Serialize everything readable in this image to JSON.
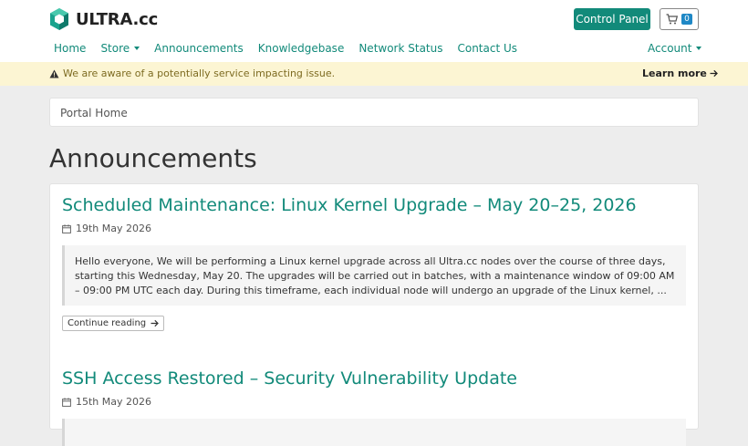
{
  "brand": {
    "name": "ULTRA.cc"
  },
  "header": {
    "control_panel_label": "Control Panel",
    "cart_count": "0"
  },
  "nav": {
    "items": [
      {
        "label": "Home"
      },
      {
        "label": "Store",
        "dropdown": true
      },
      {
        "label": "Announcements"
      },
      {
        "label": "Knowledgebase"
      },
      {
        "label": "Network Status"
      },
      {
        "label": "Contact Us"
      }
    ],
    "account_label": "Account"
  },
  "alert": {
    "message": "We are aware of a potentially service impacting issue.",
    "link_label": "Learn more"
  },
  "breadcrumb": {
    "label": "Portal Home"
  },
  "page": {
    "title": "Announcements"
  },
  "announcements": [
    {
      "title": "Scheduled Maintenance: Linux Kernel Upgrade – May 20–25, 2026",
      "date": "19th May 2026",
      "excerpt": "Hello everyone, We will be performing a Linux kernel upgrade across all Ultra.cc nodes over the course of three days, starting this Wednesday, May 20. The upgrades will be carried out in batches, with a maintenance window of 09:00 AM – 09:00 PM UTC each day. During this timeframe, each individual node will undergo an upgrade of the Linux kernel, ...",
      "more_label": "Continue reading"
    },
    {
      "title": "SSH Access Restored – Security Vulnerability Update",
      "date": "15th May 2026"
    }
  ],
  "colors": {
    "accent": "#128a7a",
    "alert_bg": "#fcf5d3",
    "badge": "#1f88c6"
  }
}
